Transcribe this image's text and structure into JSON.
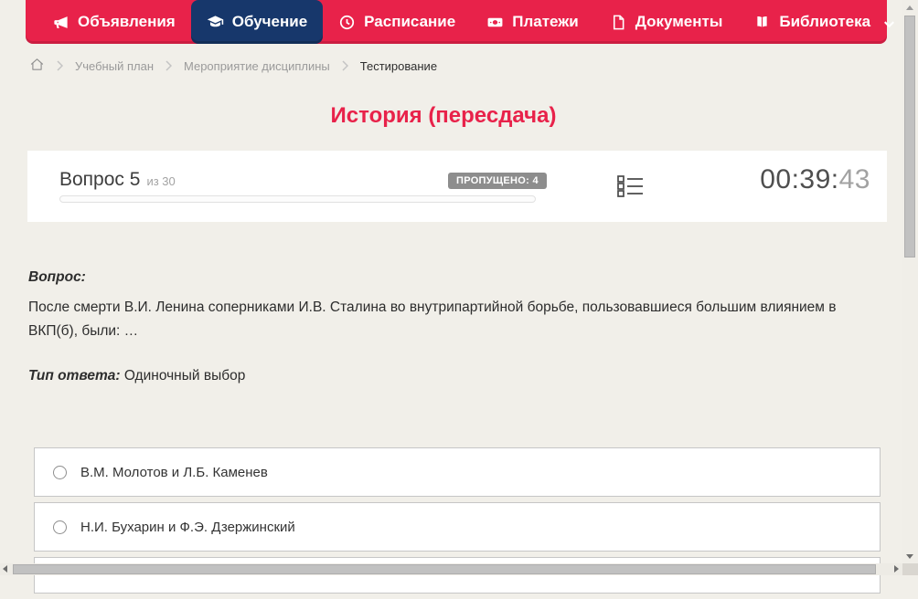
{
  "colors": {
    "accent_red": "#e8224a",
    "active_navy": "#17376b",
    "badge_gray": "#8d8d8d",
    "page_background": "#f1efe9"
  },
  "nav": {
    "items": [
      {
        "label": "Объявления",
        "icon": "megaphone"
      },
      {
        "label": "Обучение",
        "icon": "graduation-cap",
        "active": true
      },
      {
        "label": "Расписание",
        "icon": "clock"
      },
      {
        "label": "Платежи",
        "icon": "banknote"
      },
      {
        "label": "Документы",
        "icon": "document"
      },
      {
        "label": "Библиотека",
        "icon": "book",
        "has_dropdown": true
      }
    ]
  },
  "breadcrumb": {
    "items": [
      "Учебный план",
      "Мероприятие дисциплины",
      "Тестирование"
    ]
  },
  "page": {
    "title": "История (пересдача)"
  },
  "question_header": {
    "question_number": "Вопрос 5",
    "question_total": "из 30",
    "skipped_badge": "ПРОПУЩЕНО: 4",
    "timer_main": "00:39:",
    "timer_seconds": "43"
  },
  "question": {
    "label": "Вопрос:",
    "text": "После смерти В.И. Ленина соперниками И.В. Сталина во внутрипартийной борьбе, пользовавшиеся большим влиянием в ВКП(б), были: …",
    "answer_type_label": "Тип ответа:",
    "answer_type_value": "Одиночный выбор"
  },
  "options": [
    {
      "label": "В.М. Молотов и Л.Б. Каменев"
    },
    {
      "label": "Н.И. Бухарин и Ф.Э. Дзержинский"
    }
  ]
}
